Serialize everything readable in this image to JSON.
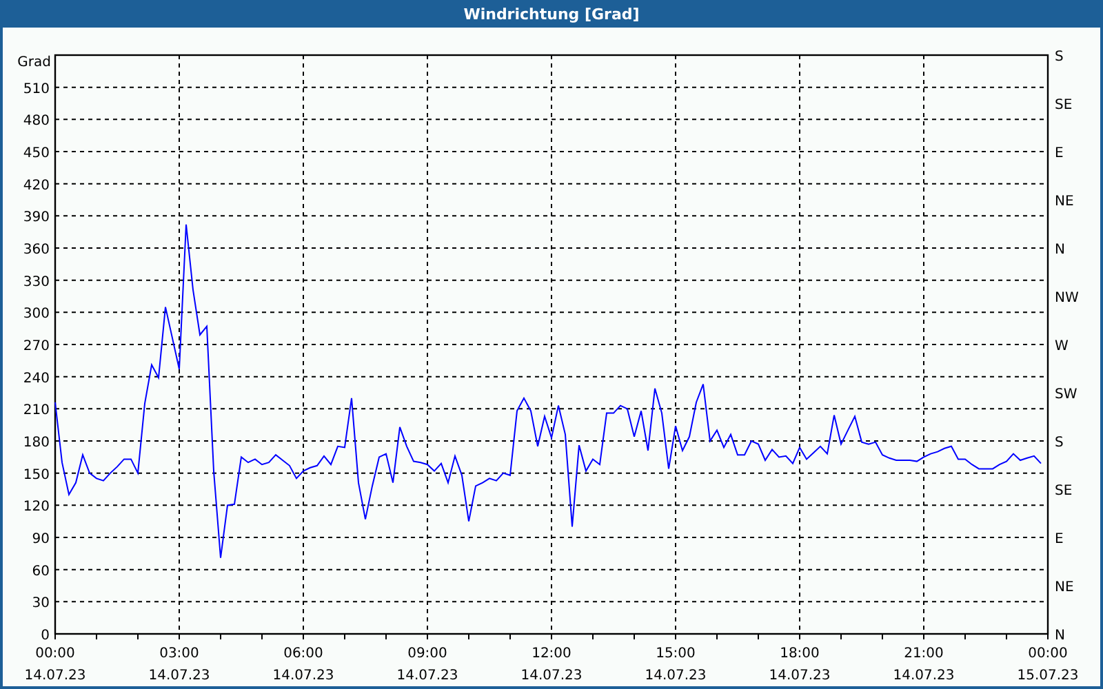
{
  "window": {
    "title": "Windrichtung [Grad]"
  },
  "chart": {
    "chart_data": {
      "type": "line",
      "grid": true,
      "ylabel": "Grad",
      "ylim": [
        0,
        540
      ],
      "yticks": [
        0,
        30,
        60,
        90,
        120,
        150,
        180,
        210,
        240,
        270,
        300,
        330,
        360,
        390,
        420,
        450,
        480,
        510
      ],
      "categories": [
        "00:00\n14.07.23",
        null,
        null,
        null,
        null,
        null,
        null,
        null,
        null,
        null,
        null,
        null,
        null,
        null,
        null,
        null,
        null,
        null,
        "03:00\n14.07.23",
        null,
        null,
        null,
        null,
        null,
        null,
        null,
        null,
        null,
        null,
        null,
        null,
        null,
        null,
        null,
        null,
        null,
        "06:00\n14.07.23",
        null,
        null,
        null,
        null,
        null,
        null,
        null,
        null,
        null,
        null,
        null,
        null,
        null,
        null,
        null,
        null,
        null,
        "09:00\n14.07.23",
        null,
        null,
        null,
        null,
        null,
        null,
        null,
        null,
        null,
        null,
        null,
        null,
        null,
        null,
        null,
        null,
        null,
        "12:00\n14.07.23",
        null,
        null,
        null,
        null,
        null,
        null,
        null,
        null,
        null,
        null,
        null,
        null,
        null,
        null,
        null,
        null,
        null,
        "15:00\n14.07.23",
        null,
        null,
        null,
        null,
        null,
        null,
        null,
        null,
        null,
        null,
        null,
        null,
        null,
        null,
        null,
        null,
        null,
        "18:00\n14.07.23",
        null,
        null,
        null,
        null,
        null,
        null,
        null,
        null,
        null,
        null,
        null,
        null,
        null,
        null,
        null,
        null,
        null,
        "21:00\n14.07.23",
        null,
        null,
        null,
        null,
        null,
        null,
        null,
        null,
        null,
        null,
        null,
        null,
        null,
        null,
        null,
        null,
        null,
        "00:00\n15.07.23"
      ],
      "series": [
        {
          "color": "#0000ff",
          "values": [
            216,
            160,
            130,
            141,
            167,
            150,
            145,
            143,
            150,
            156,
            163,
            163,
            150,
            215,
            251,
            239,
            305,
            276,
            247,
            382,
            321,
            279,
            287,
            152,
            71,
            120,
            121,
            165,
            160,
            163,
            158,
            160,
            167,
            162,
            157,
            145,
            152,
            155,
            157,
            166,
            158,
            175,
            174,
            220,
            141,
            107,
            138,
            165,
            168,
            141,
            193,
            175,
            161,
            160,
            158,
            152,
            159,
            141,
            166,
            148,
            105,
            138,
            141,
            145,
            143,
            150,
            148,
            208,
            220,
            208,
            175,
            203,
            183,
            213,
            186,
            100,
            176,
            152,
            163,
            158,
            206,
            206,
            213,
            210,
            184,
            208,
            171,
            229,
            206,
            154,
            194,
            171,
            184,
            216,
            233,
            180,
            190,
            174,
            186,
            167,
            167,
            180,
            177,
            162,
            172,
            165,
            166,
            159,
            174,
            163,
            169,
            175,
            168,
            204,
            177,
            190,
            203,
            179,
            177,
            179,
            167,
            164,
            162,
            162,
            162,
            161,
            165,
            168,
            170,
            173,
            175,
            163,
            163,
            158,
            154,
            154,
            154,
            158,
            161,
            168,
            162,
            164,
            166,
            159,
            null
          ]
        }
      ]
    },
    "right_axis": {
      "ticks": [
        "S",
        "SE",
        "E",
        "NE",
        "N",
        "NW",
        "W",
        "SW",
        "S",
        "SE",
        "E",
        "NE",
        "N"
      ]
    }
  }
}
